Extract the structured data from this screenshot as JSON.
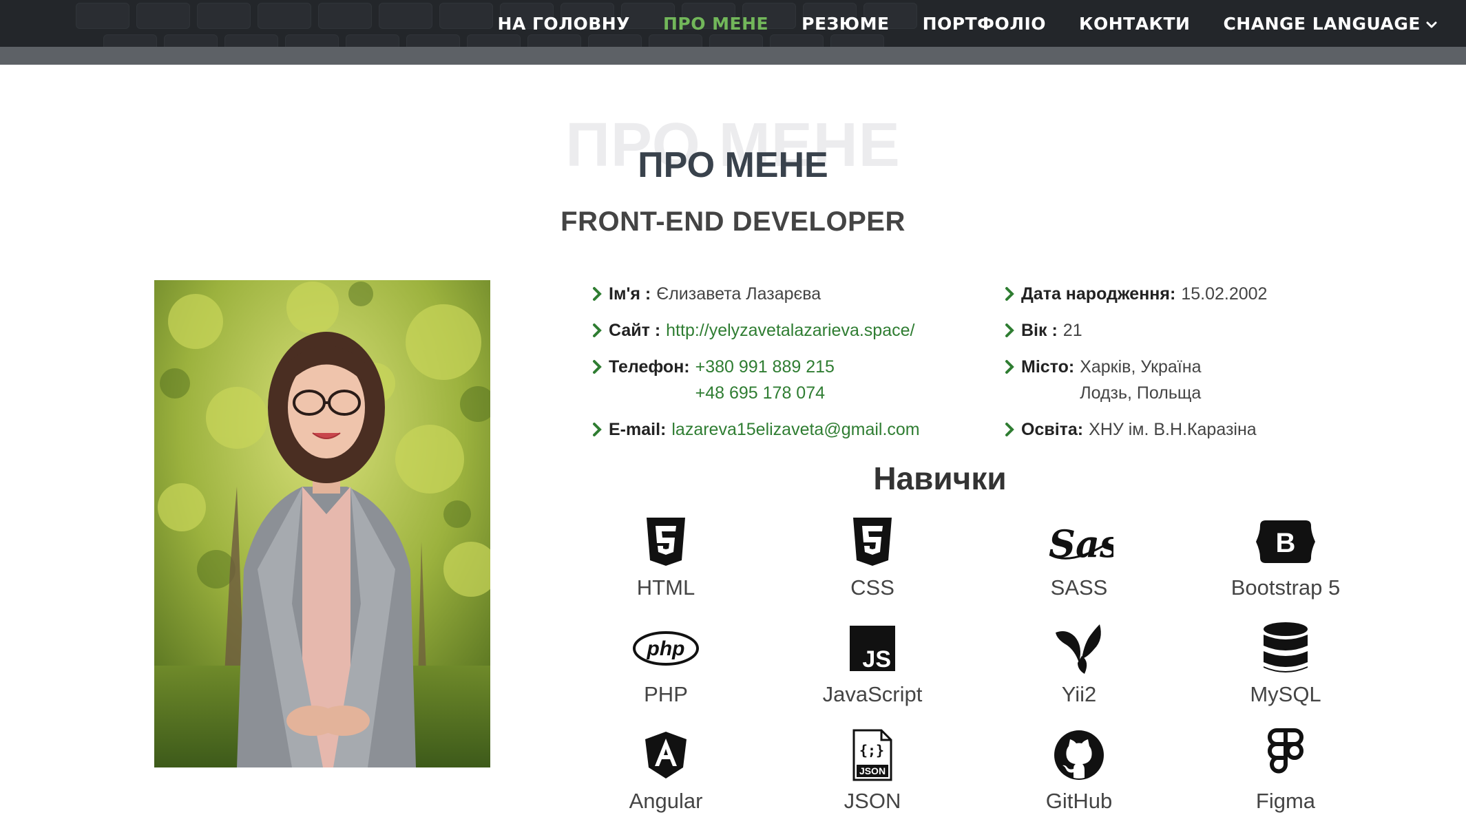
{
  "nav": {
    "items": [
      {
        "label": "НА ГОЛОВНУ",
        "active": false
      },
      {
        "label": "ПРО МЕНЕ",
        "active": true
      },
      {
        "label": "РЕЗЮМЕ",
        "active": false
      },
      {
        "label": "ПОРТФОЛІО",
        "active": false
      },
      {
        "label": "КОНТАКТИ",
        "active": false
      },
      {
        "label": "CHANGE LANGUAGE",
        "active": false
      }
    ],
    "accent_color": "#72b75a"
  },
  "section": {
    "ghost_title": "ПРО МЕНЕ",
    "title": "ПРО МЕНЕ",
    "subtitle": "FRONT-END DEVELOPER"
  },
  "info": {
    "name": {
      "label": "Ім'я :",
      "value": "Єлизавета Лазарєва"
    },
    "site": {
      "label": "Сайт :",
      "value": "http://yelyzavetalazarieva.space/"
    },
    "phone": {
      "label": "Телефон:",
      "values": [
        "+380 991 889 215",
        "+48 695 178 074"
      ]
    },
    "email": {
      "label": "E-mail:",
      "value": "lazareva15elizaveta@gmail.com"
    },
    "birth": {
      "label": "Дата народження:",
      "value": "15.02.2002"
    },
    "age": {
      "label": "Вік :",
      "value": "21"
    },
    "city": {
      "label": "Місто:",
      "values": [
        "Харків, Україна",
        "Лодзь, Польща"
      ]
    },
    "education": {
      "label": "Освіта:",
      "value": "ХНУ ім. В.Н.Каразіна"
    },
    "link_color": "#2f7d32"
  },
  "skills": {
    "title": "Навички",
    "items": [
      {
        "name": "HTML",
        "icon": "html5-icon"
      },
      {
        "name": "CSS",
        "icon": "css3-icon"
      },
      {
        "name": "SASS",
        "icon": "sass-icon"
      },
      {
        "name": "Bootstrap 5",
        "icon": "bootstrap-icon"
      },
      {
        "name": "PHP",
        "icon": "php-icon"
      },
      {
        "name": "JavaScript",
        "icon": "javascript-icon"
      },
      {
        "name": "Yii2",
        "icon": "yii-icon"
      },
      {
        "name": "MySQL",
        "icon": "database-icon"
      },
      {
        "name": "Angular",
        "icon": "angular-icon"
      },
      {
        "name": "JSON",
        "icon": "json-file-icon"
      },
      {
        "name": "GitHub",
        "icon": "github-icon"
      },
      {
        "name": "Figma",
        "icon": "figma-icon"
      }
    ]
  }
}
